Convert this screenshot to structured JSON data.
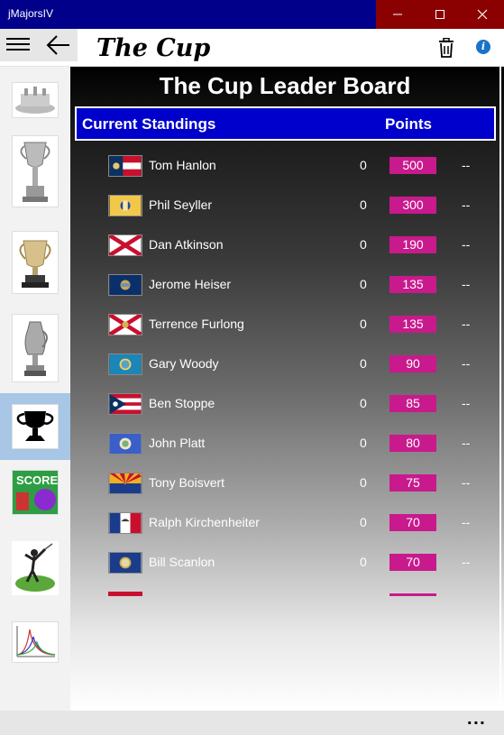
{
  "window": {
    "title": "jMajorsIV"
  },
  "appbar": {
    "title": "The Cup"
  },
  "sidebar": {
    "items": [
      {
        "icon": "silver-tray-trophy-icon",
        "active": false
      },
      {
        "icon": "us-open-cup-icon",
        "active": false
      },
      {
        "icon": "wanamaker-trophy-icon",
        "active": false
      },
      {
        "icon": "claret-jug-icon",
        "active": false
      },
      {
        "icon": "trophy-silhouette-icon",
        "active": true
      },
      {
        "icon": "scorecard-icon",
        "active": false
      },
      {
        "icon": "golfer-swing-icon",
        "active": false
      },
      {
        "icon": "stats-chart-icon",
        "active": false
      }
    ]
  },
  "board": {
    "title": "The Cup Leader Board",
    "header_left": "Current Standings",
    "header_right": "Points"
  },
  "standings": [
    {
      "name": "Tom Hanlon",
      "zero": "0",
      "points": "500",
      "dash": "--",
      "flag": "georgia"
    },
    {
      "name": "Phil Seyller",
      "zero": "0",
      "points": "300",
      "dash": "--",
      "flag": "new-jersey"
    },
    {
      "name": "Dan Atkinson",
      "zero": "0",
      "points": "190",
      "dash": "--",
      "flag": "alabama"
    },
    {
      "name": "Jerome Heiser",
      "zero": "0",
      "points": "135",
      "dash": "--",
      "flag": "pennsylvania"
    },
    {
      "name": "Terrence Furlong",
      "zero": "0",
      "points": "135",
      "dash": "--",
      "flag": "florida"
    },
    {
      "name": "Gary Woody",
      "zero": "0",
      "points": "90",
      "dash": "--",
      "flag": "south-dakota"
    },
    {
      "name": "Ben Stoppe",
      "zero": "0",
      "points": "85",
      "dash": "--",
      "flag": "ohio"
    },
    {
      "name": "John Platt",
      "zero": "0",
      "points": "80",
      "dash": "--",
      "flag": "minnesota"
    },
    {
      "name": "Tony Boisvert",
      "zero": "0",
      "points": "75",
      "dash": "--",
      "flag": "arizona"
    },
    {
      "name": "Ralph Kirchenheiter",
      "zero": "0",
      "points": "70",
      "dash": "--",
      "flag": "iowa"
    },
    {
      "name": "Bill Scanlon",
      "zero": "0",
      "points": "70",
      "dash": "--",
      "flag": "nebraska"
    }
  ],
  "colors": {
    "titlebar": "#00008b",
    "header": "#0000cc",
    "points_badge": "#c81a8c",
    "active_sidebar": "#a8c6e6"
  },
  "bottombar": {
    "more": "..."
  }
}
